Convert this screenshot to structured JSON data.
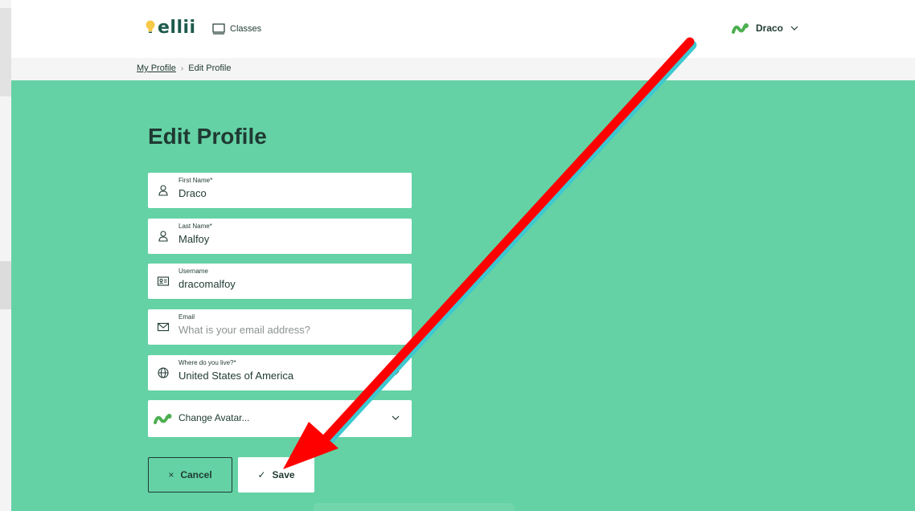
{
  "header": {
    "logo_text": "ellii",
    "nav_classes_label": "Classes",
    "user_name": "Draco"
  },
  "breadcrumb": {
    "parent": "My Profile",
    "separator": "›",
    "current": "Edit Profile"
  },
  "page": {
    "title": "Edit Profile"
  },
  "form": {
    "first_name": {
      "label": "First Name*",
      "value": "Draco"
    },
    "last_name": {
      "label": "Last Name*",
      "value": "Malfoy"
    },
    "username": {
      "label": "Username",
      "value": "dracomalfoy"
    },
    "email": {
      "label": "Email",
      "value": "",
      "placeholder": "What is your email address?"
    },
    "country": {
      "label": "Where do you live?*",
      "value": "United States of America"
    },
    "avatar": {
      "label": "Change Avatar..."
    }
  },
  "buttons": {
    "cancel_icon": "×",
    "cancel_label": "Cancel",
    "save_icon": "✓",
    "save_label": "Save"
  },
  "colors": {
    "brand_green": "#64d2a5",
    "dark_text": "#1f3a33",
    "annotation_red": "#ff0000"
  },
  "icons": {
    "logo": "lightbulb-icon",
    "classes": "monitor-icon",
    "user_avatar": "green-worm-avatar-icon",
    "first_name": "person-icon",
    "last_name": "person-icon",
    "username": "id-card-icon",
    "email": "envelope-icon",
    "country": "globe-icon",
    "dropdown": "chevron-down-icon"
  }
}
